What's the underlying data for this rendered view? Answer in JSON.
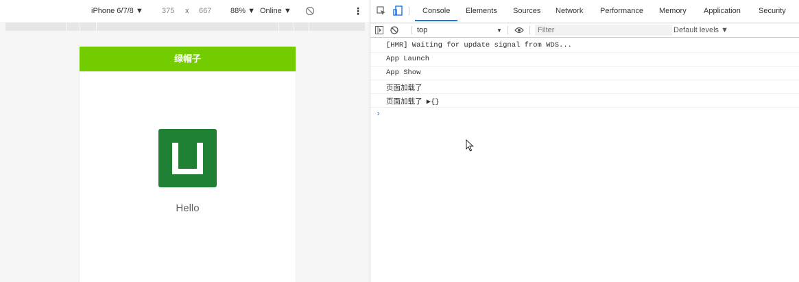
{
  "device_toolbar": {
    "device": "iPhone 6/7/8 ▼",
    "width": "375",
    "times": "x",
    "height": "667",
    "zoom": "88% ▼",
    "network": "Online ▼",
    "more": "⋮"
  },
  "app": {
    "navbar_title": "绿帽子",
    "hello_text": "Hello"
  },
  "devtools": {
    "tabs": [
      "Console",
      "Elements",
      "Sources",
      "Network",
      "Performance",
      "Memory",
      "Application",
      "Security"
    ],
    "active_tab": "Console",
    "context": "top",
    "context_arrow": "▼",
    "filter_placeholder": "Filter",
    "levels": "Default levels ▼",
    "accent_color": "#1a73e8"
  },
  "console": {
    "lines": [
      "[HMR] Waiting for update signal from WDS...",
      "App Launch",
      "App Show",
      "页面加载了",
      "页面加载了 ▶{}"
    ],
    "prompt": "›"
  },
  "colors": {
    "navbar": "#72cc00",
    "logo": "#1f8033"
  }
}
